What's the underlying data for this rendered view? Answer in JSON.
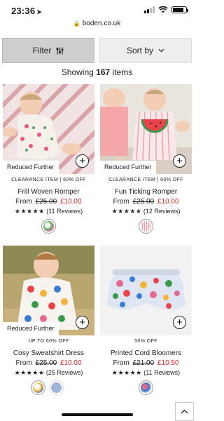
{
  "status": {
    "time": "23:36",
    "battery_level": 0.85
  },
  "browser": {
    "url": "boden.co.uk"
  },
  "toolbar": {
    "filter_label": "Filter",
    "sort_label": "Sort by"
  },
  "results": {
    "prefix": "Showing",
    "count": "167",
    "suffix": "items"
  },
  "products": [
    {
      "badge": "Reduced Further",
      "meta": "CLEARANCE ITEM  | 60% OFF",
      "name": "Frill Woven Romper",
      "price_from": "From",
      "price_was": "£25.00",
      "price_now": "£10.00",
      "stars": "★★★★★",
      "reviews": "(11 Reviews)"
    },
    {
      "badge": "Reduced Further",
      "meta": "CLEARANCE ITEM  | 60% OFF",
      "name": "Fun Ticking Romper",
      "price_from": "From",
      "price_was": "£25.00",
      "price_now": "£10.00",
      "stars": "★★★★★",
      "reviews": "(12 Reviews)"
    },
    {
      "badge": "Reduced Further",
      "meta": "UP TO 60% OFF",
      "name": "Cosy Sweatshirt Dress",
      "price_from": "From",
      "price_was": "£25.00",
      "price_now": "£10.00",
      "stars": "★★★★★",
      "reviews": "(25 Reviews)"
    },
    {
      "badge": "",
      "meta": "50% OFF",
      "name": "Printed Cord Bloomers",
      "price_from": "From",
      "price_was": "£21.00",
      "price_now": "£10.50",
      "stars": "★★★★★",
      "reviews": "(11 Reviews)"
    }
  ],
  "colors": {
    "sale_red": "#d62b2b",
    "filter_bg": "#cfcfcf",
    "sort_bg": "#eeeeee"
  }
}
